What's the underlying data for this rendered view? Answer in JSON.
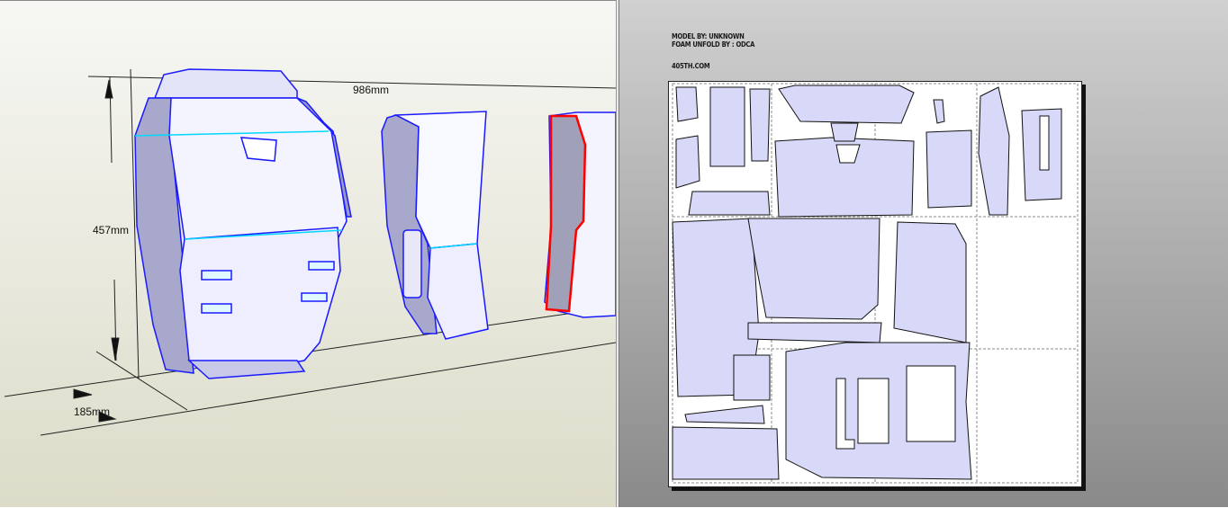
{
  "view3d": {
    "dimensions": {
      "width": "986mm",
      "height": "457mm",
      "depth": "185mm"
    }
  },
  "view2d": {
    "credits": {
      "model_by": "MODEL BY: UNKNOWN",
      "unfold_by": "FOAM UNFOLD BY : ODCA",
      "site": "405TH.COM"
    }
  },
  "colors": {
    "part_fill": "#d8d8f8",
    "edge": "#1a1aff",
    "highlight": "#ff0000"
  }
}
